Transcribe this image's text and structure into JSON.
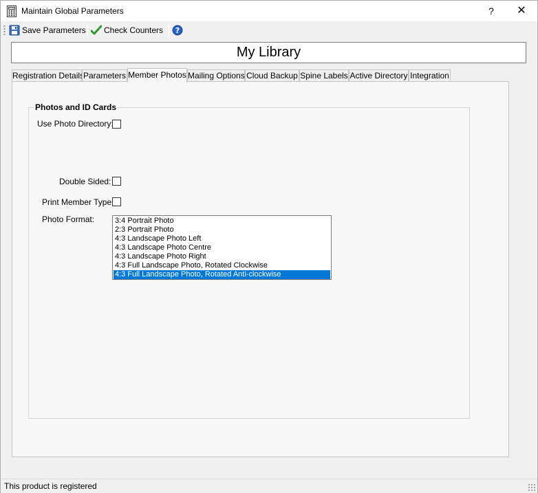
{
  "window": {
    "title": "Maintain Global Parameters",
    "help_label": "?",
    "close_label": "✕"
  },
  "toolbar": {
    "save_label": "Save Parameters",
    "check_label": "Check Counters",
    "icons": [
      "save-icon",
      "check-icon",
      "help-icon"
    ]
  },
  "library_name": "My Library",
  "tabs": [
    {
      "label": "Registration Details"
    },
    {
      "label": "Parameters"
    },
    {
      "label": "Member Photos"
    },
    {
      "label": "Mailing Options"
    },
    {
      "label": "Cloud Backup"
    },
    {
      "label": "Spine Labels"
    },
    {
      "label": "Active Directory"
    },
    {
      "label": "Integration"
    }
  ],
  "active_tab": "Member Photos",
  "group": {
    "title": "Photos and ID Cards",
    "use_photo_directory_label": "Use Photo Directory:",
    "double_sided_label": "Double Sided:",
    "print_member_type_label": "Print Member Type:",
    "photo_format_label": "Photo Format:",
    "photo_format_options": [
      "3:4 Portrait Photo",
      "2:3 Portrait Photo",
      "4:3 Landscape Photo Left",
      "4:3 Landscape Photo Centre",
      "4:3 Landscape Photo Right",
      "4:3 Full Landscape Photo, Rotated Clockwise",
      "4:3 Full Landscape Photo, Rotated Anti-clockwise"
    ],
    "photo_format_selected": "4:3 Full Landscape Photo, Rotated Anti-clockwise"
  },
  "status": {
    "text": "This product is registered"
  },
  "colors": {
    "selection": "#0078d7",
    "check_green": "#2e9a2e",
    "help_blue": "#2b63c4"
  }
}
